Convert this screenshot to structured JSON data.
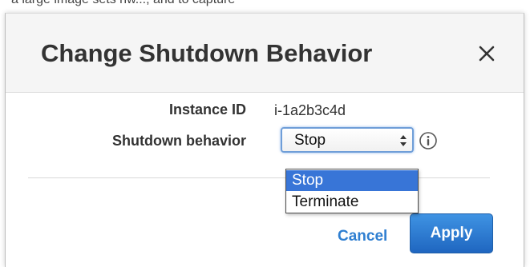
{
  "background": {
    "text": "a large image sets hw..., and to capture"
  },
  "dialog": {
    "title": "Change Shutdown Behavior",
    "close_icon": "close-icon"
  },
  "form": {
    "instance_id_label": "Instance ID",
    "instance_id_value": "i-1a2b3c4d",
    "shutdown_behavior_label": "Shutdown behavior",
    "shutdown_behavior_selected": "Stop",
    "info_icon": "info-icon",
    "shutdown_options": [
      "Stop",
      "Terminate"
    ],
    "highlighted_option": "Stop"
  },
  "footer": {
    "cancel_label": "Cancel",
    "apply_label": "Apply"
  },
  "colors": {
    "accent": "#2f7fd1",
    "primary_button": "#1f66c0",
    "selection": "#3875d7"
  }
}
